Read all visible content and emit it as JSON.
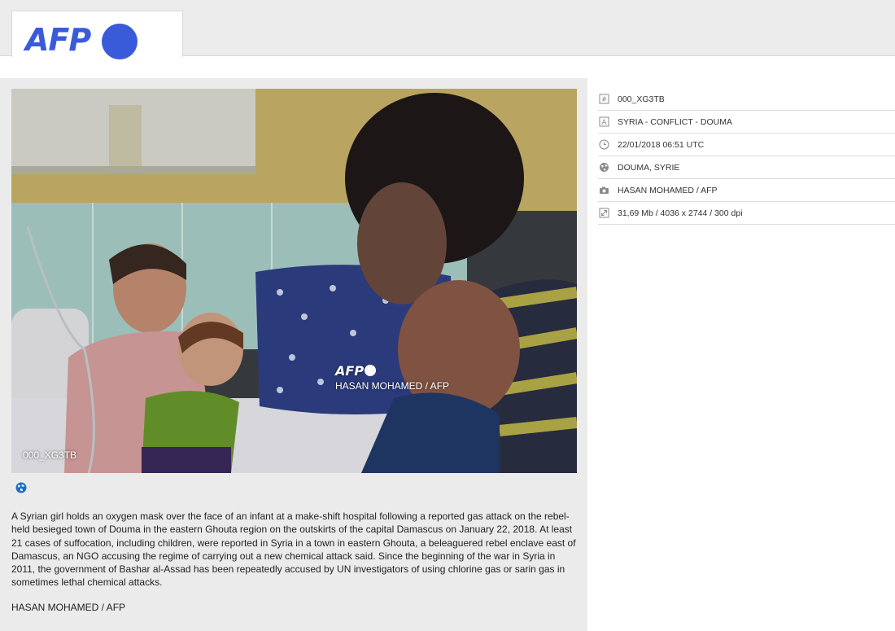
{
  "header": {
    "logo_text": "AFP",
    "brand_color": "#3a5bd9"
  },
  "photo": {
    "watermark_logo": "AFP",
    "watermark_credit": "HASAN MOHAMED / AFP",
    "id_overlay": "000_XG3TB"
  },
  "caption": "A Syrian girl holds an oxygen mask over the face of an infant at a make-shift hospital following a reported gas attack on the rebel-held besieged town of Douma in the eastern Ghouta region on the outskirts of the capital Damascus on January 22, 2018. At least 21 cases of suffocation, including children, were reported in Syria in a town in eastern Ghouta, a beleaguered rebel enclave east of Damascus, an NGO accusing the regime of carrying out a new chemical attack said. Since the beginning of the war in Syria in 2011, the government of Bashar al-Assad has been repeatedly accused by UN investigators of using chlorine gas or sarin gas in sometimes lethal chemical attacks.",
  "credit": "HASAN MOHAMED / AFP",
  "metadata": [
    {
      "icon": "id-icon",
      "text": "000_XG3TB"
    },
    {
      "icon": "title-icon",
      "text": "SYRIA - CONFLICT - DOUMA"
    },
    {
      "icon": "clock-icon",
      "text": "22/01/2018 06:51 UTC"
    },
    {
      "icon": "globe-icon",
      "text": "DOUMA, SYRIE"
    },
    {
      "icon": "camera-icon",
      "text": "HASAN MOHAMED / AFP"
    },
    {
      "icon": "resize-icon",
      "text": "31,69 Mb / 4036 x 2744 / 300 dpi"
    }
  ]
}
